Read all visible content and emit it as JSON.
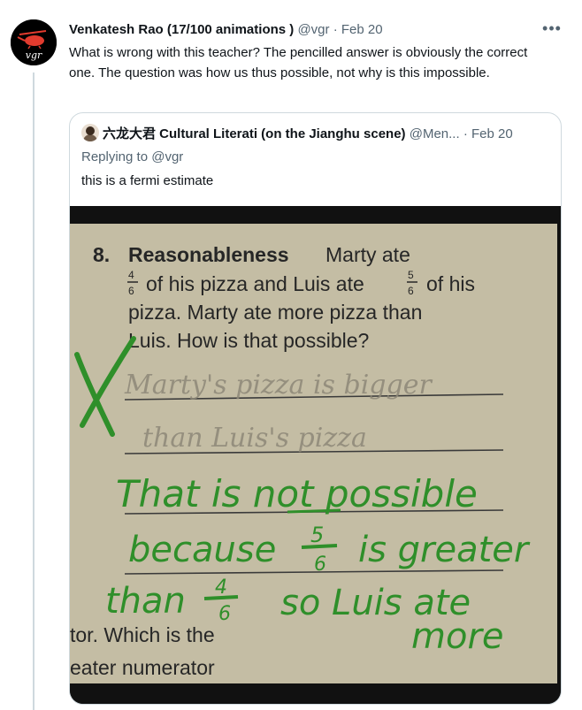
{
  "tweet": {
    "author_name": "Venkatesh Rao (17/100 animations )",
    "handle": "@vgr",
    "separator": "·",
    "date": "Feb 20",
    "avatar_text": "vgr",
    "text": "What is wrong with this teacher? The pencilled answer is obviously the correct one. The question was how us thus possible, not why is this impossible.",
    "more_icon": "more-horizontal-icon"
  },
  "quoted": {
    "author_name": "六龙大君 Cultural Literati (on the Jianghu scene)",
    "handle": "@Men...",
    "separator": "·",
    "date": "Feb 20",
    "replying_label": "Replying to",
    "replying_to": "@vgr",
    "text": "this is a fermi estimate"
  },
  "photo": {
    "question_number": "8.",
    "question_title": "Reasonableness",
    "line1_rest": "Marty ate",
    "frac_a_num": "4",
    "frac_a_den": "6",
    "line2_mid": "of his pizza and Luis ate",
    "frac_b_num": "5",
    "frac_b_den": "6",
    "line2_end": "of his",
    "line3": "pizza. Marty ate more pizza than",
    "line4": "Luis. How is that possible?",
    "pencil_line1": "Marty's pizza is bigger",
    "pencil_line2": "than Luis's pizza",
    "teacher_mark": "X",
    "green_line1": "That is not possible",
    "green_line2_a": "because",
    "green_frac_num": "5",
    "green_frac_den": "6",
    "green_line2_b": "is greater",
    "green_line3_a": "than",
    "green_frac2_num": "4",
    "green_frac2_den": "6",
    "green_line3_b": "so Luis ate",
    "green_line4": "more",
    "bottom_line1": "tor. Which is the",
    "bottom_line2": "eater numerator",
    "colors": {
      "paper": "#c9c2a9",
      "ink_green": "#2f8f2a",
      "pencil": "#8a8578",
      "print": "#2a2a2a"
    }
  }
}
